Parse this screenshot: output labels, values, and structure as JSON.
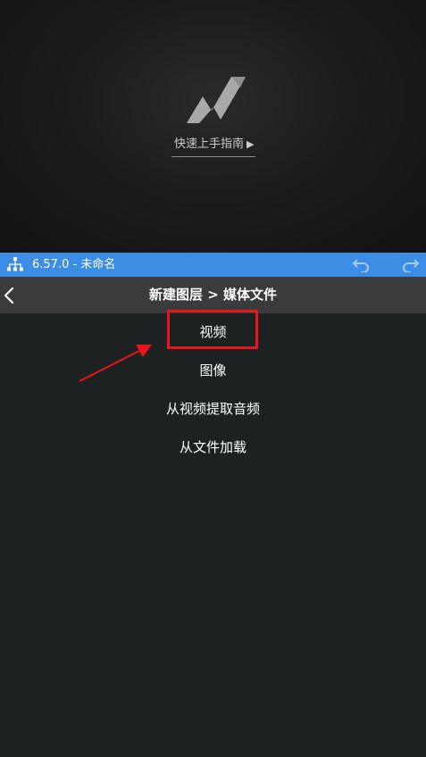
{
  "preview": {
    "logo_icon": "nleditor-logo-icon",
    "guide_label": "快速上手指南",
    "guide_arrow": "▶"
  },
  "statusbar": {
    "version_text": "6.57.0 - 未命名",
    "layers_icon": "project-tree-icon",
    "undo_icon": "undo-icon",
    "redo_icon": "redo-icon",
    "bg_color": "#3b8de6"
  },
  "header": {
    "back_icon": "chevron-left-icon",
    "title": "新建图层 > 媒体文件"
  },
  "menu": {
    "items": [
      {
        "label": "视频"
      },
      {
        "label": "图像"
      },
      {
        "label": "从视频提取音频"
      },
      {
        "label": "从文件加载"
      }
    ]
  },
  "annotation": {
    "highlight_color": "#e8151a"
  }
}
